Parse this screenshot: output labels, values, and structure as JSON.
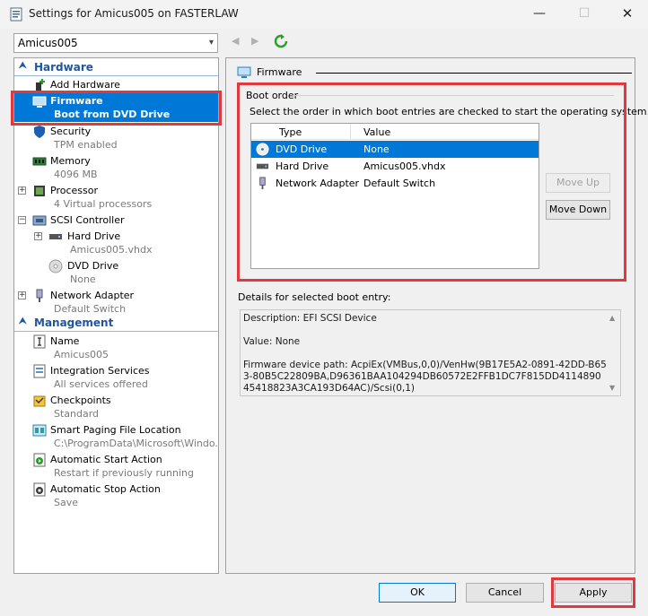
{
  "window": {
    "title": "Settings for Amicus005 on FASTERLAW",
    "minimize": "—",
    "maximize": "☐",
    "close": "✕"
  },
  "toolbar": {
    "vm_selected": "Amicus005",
    "back_glyph": "◀",
    "forward_glyph": "▶"
  },
  "sidebar": {
    "hardware_header": "Hardware",
    "management_header": "Management",
    "hardware_items": [
      {
        "label": "Add Hardware",
        "sub": "",
        "icon": "add-hardware-icon"
      },
      {
        "label": "Firmware",
        "sub": "Boot from DVD Drive",
        "icon": "firmware-icon"
      },
      {
        "label": "Security",
        "sub": "TPM enabled",
        "icon": "shield-icon"
      },
      {
        "label": "Memory",
        "sub": "4096 MB",
        "icon": "memory-icon"
      },
      {
        "label": "Processor",
        "sub": "4 Virtual processors",
        "icon": "processor-icon"
      },
      {
        "label": "SCSI Controller",
        "sub": "",
        "icon": "scsi-controller-icon"
      },
      {
        "label": "Hard Drive",
        "sub": "Amicus005.vhdx",
        "icon": "hard-drive-icon"
      },
      {
        "label": "DVD Drive",
        "sub": "None",
        "icon": "dvd-drive-icon"
      },
      {
        "label": "Network Adapter",
        "sub": "Default Switch",
        "icon": "network-adapter-icon"
      }
    ],
    "management_items": [
      {
        "label": "Name",
        "sub": "Amicus005",
        "icon": "name-icon"
      },
      {
        "label": "Integration Services",
        "sub": "All services offered",
        "icon": "integration-services-icon"
      },
      {
        "label": "Checkpoints",
        "sub": "Standard",
        "icon": "checkpoints-icon"
      },
      {
        "label": "Smart Paging File Location",
        "sub": "C:\\ProgramData\\Microsoft\\Windo...",
        "icon": "smart-paging-icon"
      },
      {
        "label": "Automatic Start Action",
        "sub": "Restart if previously running",
        "icon": "automatic-start-icon"
      },
      {
        "label": "Automatic Stop Action",
        "sub": "Save",
        "icon": "automatic-stop-icon"
      }
    ]
  },
  "main": {
    "section_title": "Firmware",
    "boot_order_label": "Boot order",
    "boot_order_desc": "Select the order in which boot entries are checked to start the operating system.",
    "columns": [
      "Type",
      "Value"
    ],
    "boot_entries": [
      {
        "type": "DVD Drive",
        "value": "None",
        "icon": "dvd-drive-icon"
      },
      {
        "type": "Hard Drive",
        "value": "Amicus005.vhdx",
        "icon": "hard-drive-icon"
      },
      {
        "type": "Network Adapter",
        "value": "Default Switch",
        "icon": "network-adapter-icon"
      }
    ],
    "move_up": "Move Up",
    "move_down": "Move Down",
    "details_label": "Details for selected boot entry:",
    "details_text": "Description: EFI SCSI Device\n\nValue: None\n\nFirmware device path: AcpiEx(VMBus,0,0)/VenHw(9B17E5A2-0891-42DD-B653-80B5C22809BA,D96361BAA104294DB60572E2FFB1DC7F815DD411489045418823A3CA193D64AC)/Scsi(0,1)"
  },
  "footer": {
    "ok": "OK",
    "cancel": "Cancel",
    "apply": "Apply"
  },
  "colors": {
    "selection": "#0078d7",
    "highlight_box": "#e0393e",
    "section_header": "#2255a0"
  }
}
